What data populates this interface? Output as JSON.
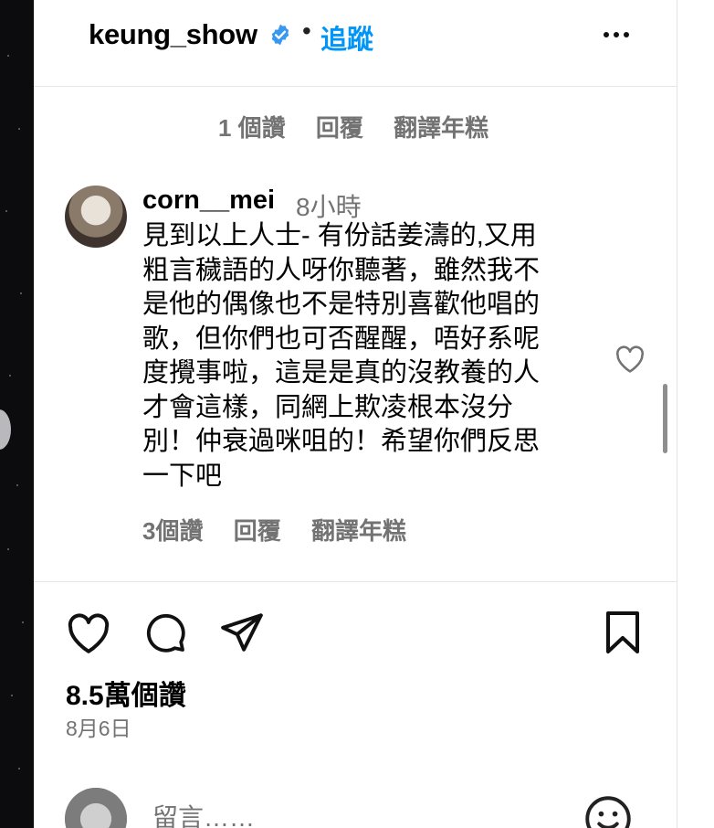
{
  "header": {
    "username": "keung_show",
    "verified_icon": "verified-badge-icon",
    "separator": "•",
    "follow_label": "追蹤",
    "more_icon": "more-horizontal-icon",
    "accent_color": "#0095f6"
  },
  "comments": [
    {
      "cut_text": "",
      "actions": {
        "likes": "1 個讚",
        "reply": "回覆",
        "translate": "翻譯年糕"
      }
    },
    {
      "username": "corn__mei",
      "time": "8小時",
      "lines": [
        "見到以上人士- 有份話姜濤的,又用",
        "粗言穢語的人呀你聽著，雖然我不",
        "是他的偶像也不是特別喜歡他唱的",
        "歌，但你們也可否醒醒，唔好系呢",
        "度攪事啦，這是是真的沒教養的人",
        "才會這樣，同網上欺凌根本沒分",
        "別！仲衰過咪咀的！希望你們反思",
        "一下吧"
      ],
      "actions": {
        "likes": "3個讚",
        "reply": "回覆",
        "translate": "翻譯年糕"
      },
      "like_icon": "heart-outline-icon"
    }
  ],
  "action_bar": {
    "like_icon": "heart-outline-icon",
    "comment_icon": "comment-bubble-icon",
    "share_icon": "paper-plane-icon",
    "save_icon": "bookmark-icon"
  },
  "post": {
    "likes": "8.5萬個讚",
    "date": "8月6日"
  },
  "comment_box": {
    "placeholder": "留言……",
    "emoji_icon": "emoji-smile-icon"
  }
}
